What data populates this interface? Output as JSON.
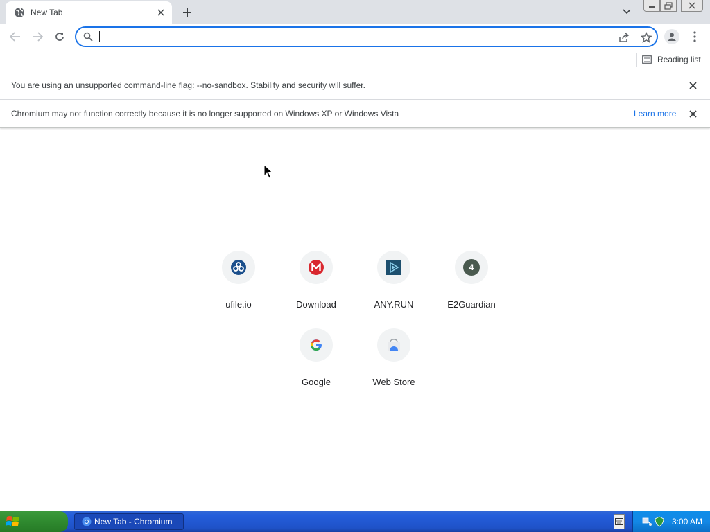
{
  "tab": {
    "title": "New Tab",
    "favicon": "globe-icon"
  },
  "omnibox": {
    "value": "",
    "placeholder": ""
  },
  "bookmarks": {
    "reading_list_label": "Reading list"
  },
  "infobars": [
    {
      "message": "You are using an unsupported command-line flag: --no-sandbox. Stability and security will suffer."
    },
    {
      "message": "Chromium may not function correctly because it is no longer supported on Windows XP or Windows Vista",
      "link": "Learn more"
    }
  ],
  "shortcuts": [
    {
      "label": "ufile.io",
      "icon": "ufile-icon"
    },
    {
      "label": "Download",
      "icon": "mega-icon"
    },
    {
      "label": "ANY.RUN",
      "icon": "anyrun-icon"
    },
    {
      "label": "E2Guardian",
      "icon": "letter-4-icon",
      "letter": "4"
    },
    {
      "label": "Google",
      "icon": "google-icon",
      "letter": "G"
    },
    {
      "label": "Web Store",
      "icon": "webstore-icon"
    }
  ],
  "taskbar": {
    "task_title": "New Tab - Chromium",
    "clock": "3:00 AM"
  },
  "colors": {
    "accent": "#1a73e8",
    "taskbar": "#245edb",
    "start": "#2f8a2f",
    "tray": "#1388e6"
  }
}
